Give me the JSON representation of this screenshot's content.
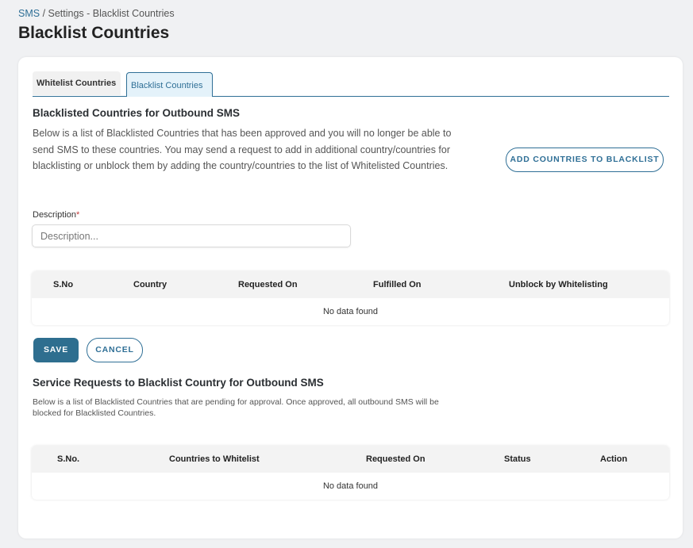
{
  "breadcrumb": {
    "root": "SMS",
    "rest": " / Settings - Blacklist Countries"
  },
  "page_title": "Blacklist Countries",
  "tabs": [
    {
      "label": "Whitelist Countries",
      "active": false
    },
    {
      "label": "Blacklist Countries",
      "active": true
    }
  ],
  "blacklist_section": {
    "title": "Blacklisted Countries for Outbound SMS",
    "description": "Below is a list of Blacklisted Countries that has been approved and you will no longer be able to send SMS to these countries. You may send a request to add in additional country/countries for blacklisting or unblock them by adding the country/countries to the list of Whitelisted Countries.",
    "add_button": "ADD COUNTRIES TO BLACKLIST",
    "field_label": "Description",
    "field_required_mark": "*",
    "field_placeholder": "Description...",
    "table": {
      "columns": [
        "S.No",
        "Country",
        "Requested On",
        "Fulfilled On",
        "Unblock by Whitelisting"
      ],
      "empty_text": "No data found"
    },
    "save_button": "SAVE",
    "cancel_button": "CANCEL"
  },
  "requests_section": {
    "title": "Service Requests to Blacklist Country for Outbound SMS",
    "description": "Below is a list of Blacklisted Countries that are pending for approval. Once approved, all outbound SMS will be blocked for Blacklisted Countries.",
    "table": {
      "columns": [
        "S.No.",
        "Countries to Whitelist",
        "Requested On",
        "Status",
        "Action"
      ],
      "empty_text": "No data found"
    }
  },
  "colors": {
    "accent": "#2f6f96",
    "save_button_bg": "#2e6e8f",
    "required_mark": "#c23b3b",
    "page_bg": "#f0f1f3"
  }
}
